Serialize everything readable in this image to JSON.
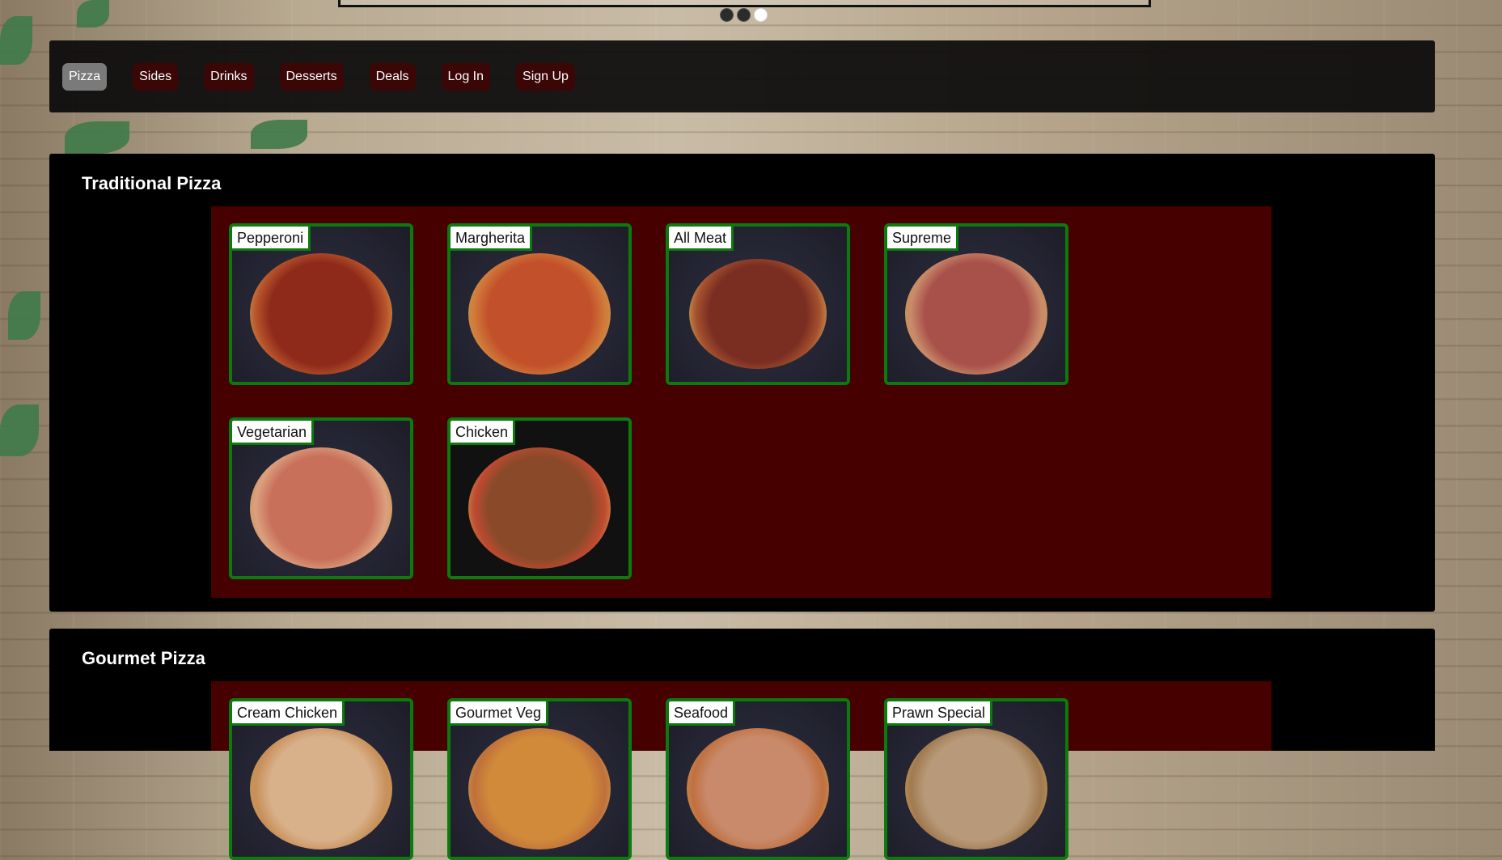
{
  "carousel": {
    "slides": 3,
    "active_slide": 3
  },
  "nav": {
    "items": [
      {
        "label": "Pizza",
        "active": true
      },
      {
        "label": "Sides",
        "active": false
      },
      {
        "label": "Drinks",
        "active": false
      },
      {
        "label": "Desserts",
        "active": false
      },
      {
        "label": "Deals",
        "active": false
      },
      {
        "label": "Log In",
        "active": false
      },
      {
        "label": "Sign Up",
        "active": false
      }
    ]
  },
  "sections": [
    {
      "title": "Traditional Pizza",
      "items": [
        {
          "name": "Pepperoni"
        },
        {
          "name": "Margherita"
        },
        {
          "name": "All Meat"
        },
        {
          "name": "Supreme"
        },
        {
          "name": "Vegetarian"
        },
        {
          "name": "Chicken"
        }
      ]
    },
    {
      "title": "Gourmet Pizza",
      "items": [
        {
          "name": "Cream Chicken"
        },
        {
          "name": "Gourmet Veg"
        },
        {
          "name": "Seafood"
        },
        {
          "name": "Prawn Special"
        }
      ]
    }
  ],
  "colors": {
    "nav_active": "#7a7a7a",
    "nav_button": "#3a0606",
    "grid_background": "#460000",
    "card_border": "#0d7a0d"
  }
}
